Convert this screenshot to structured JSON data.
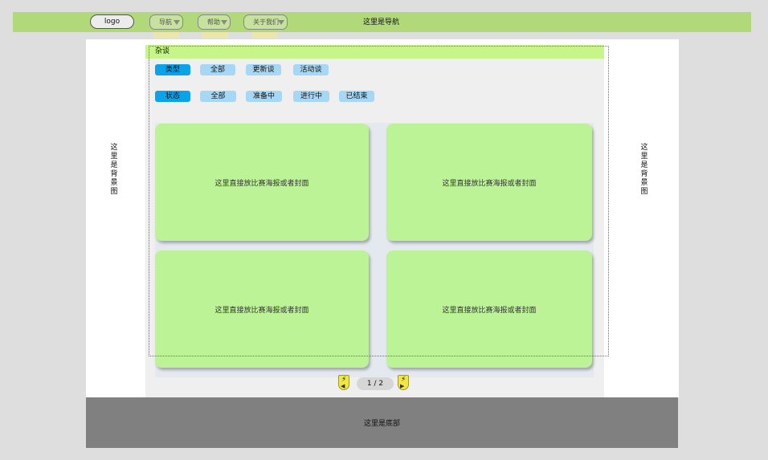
{
  "navbar": {
    "logo_label": "logo",
    "menus": [
      {
        "label": "导航"
      },
      {
        "label": "帮助"
      },
      {
        "label": "关于我们"
      }
    ],
    "title": "这里是导航",
    "bg_color": "#b1d97a"
  },
  "background": {
    "left_label": "这里是背景图",
    "right_label": "这里是背景图"
  },
  "section": {
    "title": "杂谈",
    "title_bg": "#c7f58a"
  },
  "filters": {
    "type": {
      "head": "类型",
      "options": [
        "全部",
        "更新谈",
        "活动谈"
      ]
    },
    "status": {
      "head": "状态",
      "options": [
        "全部",
        "准备中",
        "进行中",
        "已结束"
      ]
    }
  },
  "cards": [
    {
      "text": "这里直接放比赛海报或者封面"
    },
    {
      "text": "这里直接放比赛海报或者封面"
    },
    {
      "text": "这里直接放比赛海报或者封面"
    },
    {
      "text": "这里直接放比赛海报或者封面"
    }
  ],
  "pagination": {
    "label": "1 / 2",
    "current": 1,
    "total": 2,
    "prev_icon": "lightning-left-arrow-icon",
    "next_icon": "lightning-right-arrow-icon"
  },
  "footer": {
    "text": "这里是底部",
    "bg_color": "#808080"
  }
}
